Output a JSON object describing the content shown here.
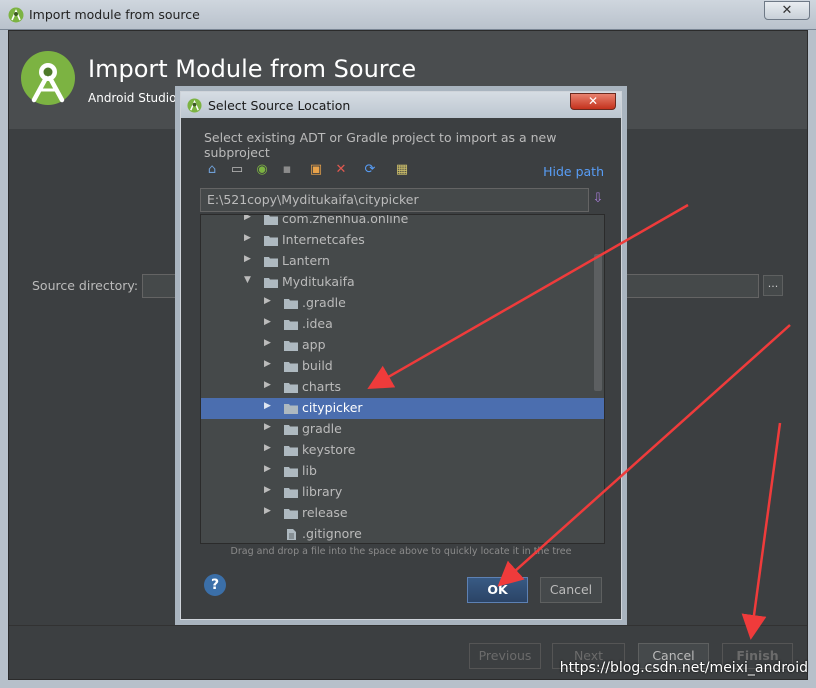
{
  "window": {
    "title": "Import module from source",
    "close_glyph": "✕",
    "icon": "android-studio-icon"
  },
  "header": {
    "title": "Import Module from Source",
    "subtitle": "Android Studio",
    "logo": "android-studio-logo"
  },
  "form": {
    "source_label": "Source directory:",
    "source_value": "",
    "browse_label": "..."
  },
  "footer": {
    "previous": "Previous",
    "next": "Next",
    "cancel": "Cancel",
    "finish": "Finish"
  },
  "watermark": "https://blog.csdn.net/meixi_android",
  "dialog": {
    "title": "Select Source Location",
    "close_glyph": "✕",
    "description": "Select existing ADT or Gradle project to import as a new subproject",
    "toolbar": [
      {
        "name": "home-icon",
        "glyph": "⌂",
        "color": "#6f9fd6"
      },
      {
        "name": "desktop-icon",
        "glyph": "▭",
        "color": "#bbbbbb"
      },
      {
        "name": "android-project-icon",
        "glyph": "◉",
        "color": "#7cb342"
      },
      {
        "name": "module-icon",
        "glyph": "▪",
        "color": "#8c8c8c"
      },
      {
        "name": "new-folder-icon",
        "glyph": "▣",
        "color": "#e8a24a"
      },
      {
        "name": "delete-icon",
        "glyph": "✕",
        "color": "#e0584f"
      },
      {
        "name": "refresh-icon",
        "glyph": "⟳",
        "color": "#589df6"
      },
      {
        "name": "show-hidden-icon",
        "glyph": "▦",
        "color": "#d1c26a"
      }
    ],
    "hide_path": "Hide path",
    "path_value": "E:\\521copy\\Myditukaifa\\citypicker",
    "tree": [
      {
        "label": "com.zhenhua.online",
        "level": 1,
        "expanded": false,
        "type": "folder",
        "selected": false
      },
      {
        "label": "Internetcafes",
        "level": 1,
        "expanded": false,
        "type": "folder",
        "selected": false
      },
      {
        "label": "Lantern",
        "level": 1,
        "expanded": false,
        "type": "folder",
        "selected": false
      },
      {
        "label": "Myditukaifa",
        "level": 1,
        "expanded": true,
        "type": "folder",
        "selected": false
      },
      {
        "label": ".gradle",
        "level": 2,
        "expanded": false,
        "type": "folder",
        "selected": false
      },
      {
        "label": ".idea",
        "level": 2,
        "expanded": false,
        "type": "folder",
        "selected": false
      },
      {
        "label": "app",
        "level": 2,
        "expanded": false,
        "type": "folder",
        "selected": false
      },
      {
        "label": "build",
        "level": 2,
        "expanded": false,
        "type": "folder",
        "selected": false
      },
      {
        "label": "charts",
        "level": 2,
        "expanded": false,
        "type": "folder",
        "selected": false
      },
      {
        "label": "citypicker",
        "level": 2,
        "expanded": false,
        "type": "folder",
        "selected": true
      },
      {
        "label": "gradle",
        "level": 2,
        "expanded": false,
        "type": "folder",
        "selected": false
      },
      {
        "label": "keystore",
        "level": 2,
        "expanded": false,
        "type": "folder",
        "selected": false
      },
      {
        "label": "lib",
        "level": 2,
        "expanded": false,
        "type": "folder",
        "selected": false
      },
      {
        "label": "library",
        "level": 2,
        "expanded": false,
        "type": "folder",
        "selected": false
      },
      {
        "label": "release",
        "level": 2,
        "expanded": false,
        "type": "folder",
        "selected": false
      },
      {
        "label": ".gitignore",
        "level": 2,
        "expanded": false,
        "type": "file",
        "selected": false
      }
    ],
    "drag_hint": "Drag and drop a file into the space above to quickly locate it in the tree",
    "help": "?",
    "ok": "OK",
    "cancel": "Cancel"
  },
  "colors": {
    "background": "#3c3f41",
    "selection": "#4b6eaf",
    "link": "#589df6",
    "annotation_arrow": "#ef3b3b",
    "folder": "#aeb9c0"
  }
}
